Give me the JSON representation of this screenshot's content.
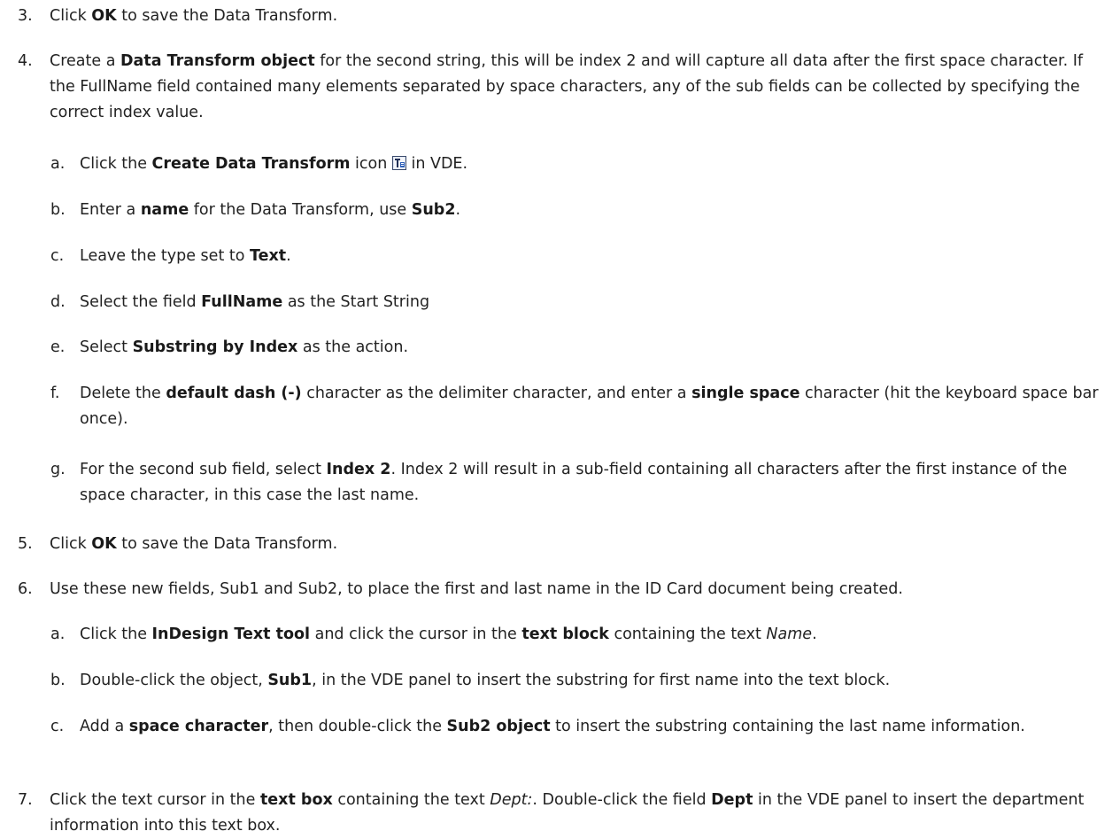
{
  "steps": [
    {
      "num": "3.",
      "parts": [
        [
          "t",
          "Click "
        ],
        [
          "b",
          "OK"
        ],
        [
          "t",
          " to save the Data Transform."
        ]
      ]
    },
    {
      "num": "4.",
      "parts": [
        [
          "t",
          "Create a "
        ],
        [
          "b",
          "Data Transform object"
        ],
        [
          "t",
          " for the second string, this will be index 2 and will capture all data after the first space character. If the FullName field contained many elements separated by space characters, any of the sub fields can be collected by specifying the correct index value."
        ]
      ]
    },
    {
      "num": "a.",
      "sub": true,
      "parts": [
        [
          "t",
          "Click the "
        ],
        [
          "b",
          "Create Data Transform"
        ],
        [
          "t",
          " icon "
        ],
        [
          "icon",
          "create-data-transform-icon"
        ],
        [
          "t",
          " in VDE."
        ]
      ]
    },
    {
      "num": "b.",
      "sub": true,
      "parts": [
        [
          "t",
          "Enter a "
        ],
        [
          "b",
          "name"
        ],
        [
          "t",
          " for the Data Transform, use "
        ],
        [
          "b",
          "Sub2"
        ],
        [
          "t",
          "."
        ]
      ]
    },
    {
      "num": "c.",
      "sub": true,
      "parts": [
        [
          "t",
          "Leave the type set to "
        ],
        [
          "b",
          "Text"
        ],
        [
          "t",
          "."
        ]
      ]
    },
    {
      "num": "d.",
      "sub": true,
      "parts": [
        [
          "t",
          "Select the field "
        ],
        [
          "b",
          "FullName"
        ],
        [
          "t",
          " as the Start String"
        ]
      ]
    },
    {
      "num": "e.",
      "sub": true,
      "parts": [
        [
          "t",
          "Select "
        ],
        [
          "b",
          "Substring by Index"
        ],
        [
          "t",
          " as the action."
        ]
      ]
    },
    {
      "num": "f.",
      "sub": true,
      "parts": [
        [
          "t",
          "Delete the "
        ],
        [
          "b",
          "default dash (-)"
        ],
        [
          "t",
          " character as the delimiter character, and enter a "
        ],
        [
          "b",
          "single space"
        ],
        [
          "t",
          " character (hit the keyboard space bar once)."
        ]
      ]
    },
    {
      "num": "g.",
      "sub": true,
      "parts": [
        [
          "t",
          "For the second sub field, select "
        ],
        [
          "b",
          "Index 2"
        ],
        [
          "t",
          ". Index 2 will result in a sub-field containing all characters after the first instance of the space character, in this case the last name."
        ]
      ]
    },
    {
      "num": "5.",
      "parts": [
        [
          "t",
          "Click "
        ],
        [
          "b",
          "OK"
        ],
        [
          "t",
          " to save the Data Transform."
        ]
      ]
    },
    {
      "num": "6.",
      "parts": [
        [
          "t",
          "Use these new fields, Sub1 and Sub2, to place the first and last name in the ID Card document being created."
        ]
      ]
    },
    {
      "num": "a.",
      "sub": true,
      "parts": [
        [
          "t",
          "Click the "
        ],
        [
          "b",
          "InDesign Text tool"
        ],
        [
          "t",
          " and click the cursor in the "
        ],
        [
          "b",
          "text block"
        ],
        [
          "t",
          " containing the text "
        ],
        [
          "i",
          "Name"
        ],
        [
          "t",
          "."
        ]
      ]
    },
    {
      "num": "b.",
      "sub": true,
      "parts": [
        [
          "t",
          "Double-click the object, "
        ],
        [
          "b",
          "Sub1"
        ],
        [
          "t",
          ", in the VDE panel to insert the substring for first name into the text block."
        ]
      ]
    },
    {
      "num": "c.",
      "sub": true,
      "parts": [
        [
          "t",
          "Add a "
        ],
        [
          "b",
          "space character"
        ],
        [
          "t",
          ", then double-click the "
        ],
        [
          "b",
          "Sub2 object"
        ],
        [
          "t",
          " to insert the substring containing the last name information."
        ]
      ]
    },
    {
      "num": "7.",
      "parts": [
        [
          "t",
          "Click the text cursor in the "
        ],
        [
          "b",
          "text box"
        ],
        [
          "t",
          " containing the text "
        ],
        [
          "i",
          "Dept:"
        ],
        [
          "t",
          ". Double-click the field "
        ],
        [
          "b",
          "Dept"
        ],
        [
          "t",
          " in the VDE panel to insert the department information into this text box."
        ]
      ]
    }
  ]
}
